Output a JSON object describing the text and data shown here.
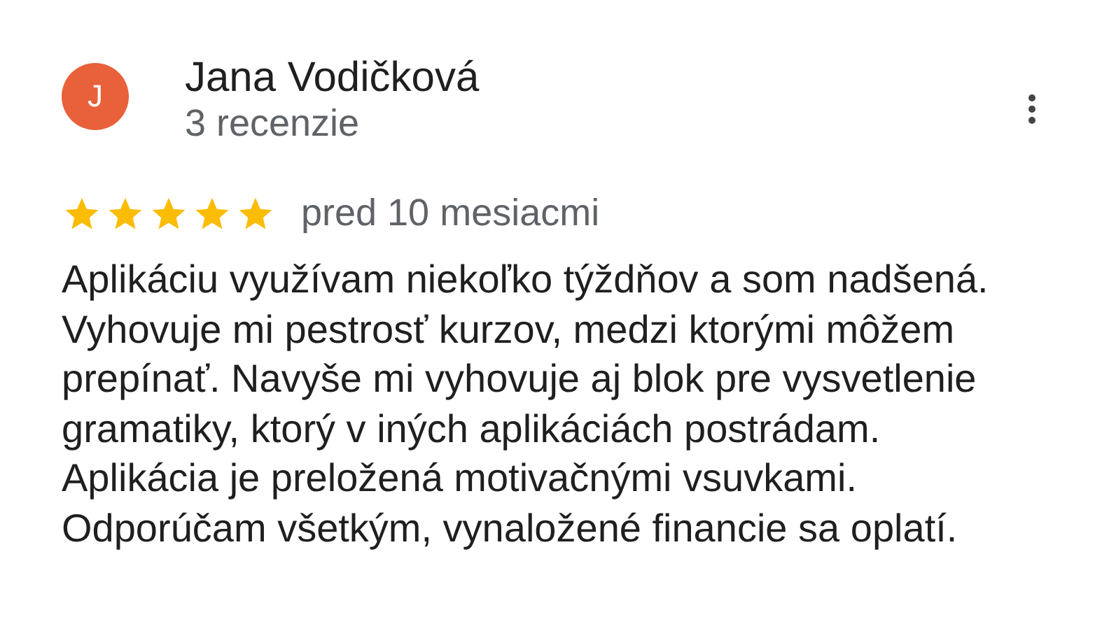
{
  "review": {
    "avatar_letter": "J",
    "author": "Jana Vodičková",
    "review_count": "3 recenzie",
    "stars": 5,
    "time": "pred 10 mesiacmi",
    "text": "Aplikáciu využívam niekoľko týždňov a som nadšená. Vyhovuje mi pestrosť kurzov, medzi ktorými môžem prepínať. Navyše mi vyhovuje aj blok pre vysvetlenie gramatiky, ktorý v iných aplikáciách postrádam. Aplikácia je preložená motivačnými vsuvkami. Odporúčam všetkým, vynaložené financie sa oplatí."
  }
}
